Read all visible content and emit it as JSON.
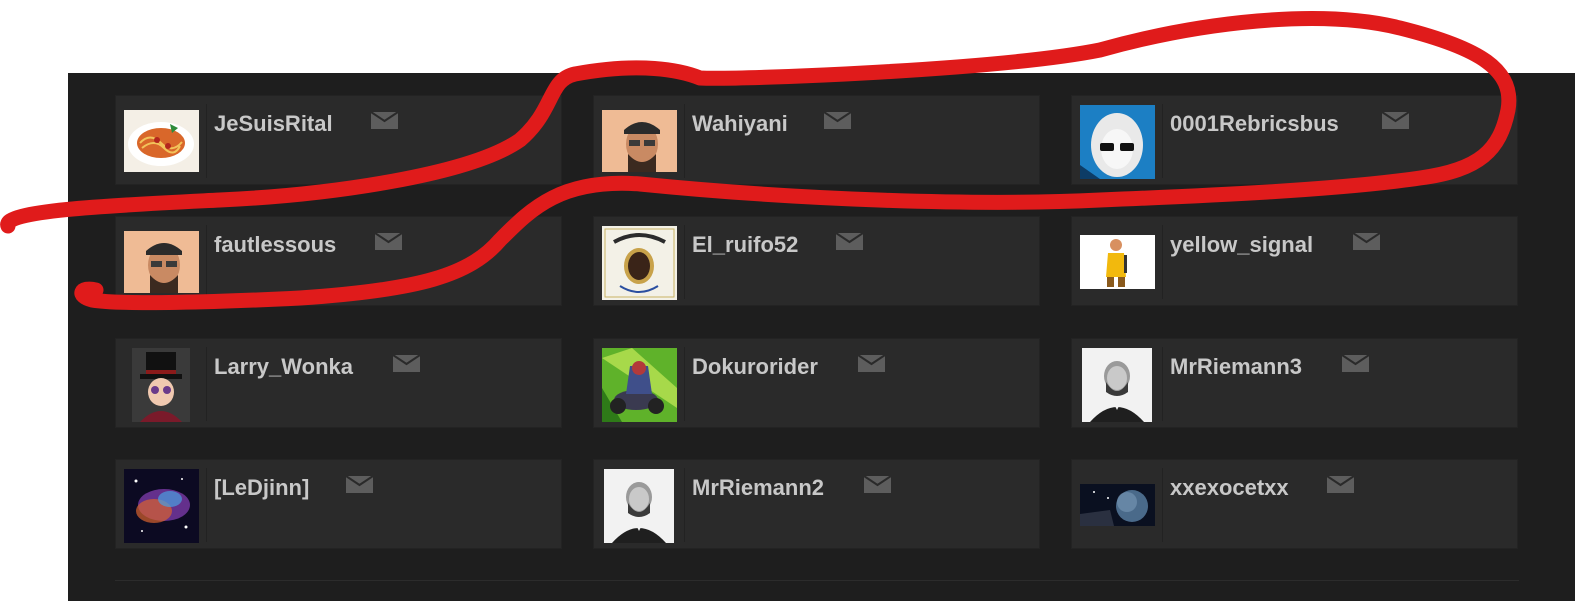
{
  "friends": [
    {
      "name": "JeSuisRital",
      "avatar": "spaghetti-avatar"
    },
    {
      "name": "Wahiyani",
      "avatar": "man-in-cap-avatar"
    },
    {
      "name": "0001Rebricsbus",
      "avatar": "hooded-figure-avatar"
    },
    {
      "name": "fautlessous",
      "avatar": "man-in-cap-avatar"
    },
    {
      "name": "El_ruifo52",
      "avatar": "dr-dre-album-avatar"
    },
    {
      "name": "yellow_signal",
      "avatar": "yellow-character-avatar"
    },
    {
      "name": "Larry_Wonka",
      "avatar": "top-hat-avatar"
    },
    {
      "name": "Dokurorider",
      "avatar": "robot-rider-avatar"
    },
    {
      "name": "MrRiemann3",
      "avatar": "riemann-portrait-avatar"
    },
    {
      "name": "[LeDjinn]",
      "avatar": "nebula-avatar"
    },
    {
      "name": "MrRiemann2",
      "avatar": "riemann-portrait-avatar"
    },
    {
      "name": "xxexocetxx",
      "avatar": "planet-space-avatar"
    }
  ],
  "icons": {
    "message": "envelope-icon"
  },
  "colors": {
    "panel": "#1e1e1e",
    "card": "#2a2a2a",
    "name_text": "#c8c8c8",
    "envelope": "#5d5d5d",
    "annotation": "#e01b1b"
  }
}
